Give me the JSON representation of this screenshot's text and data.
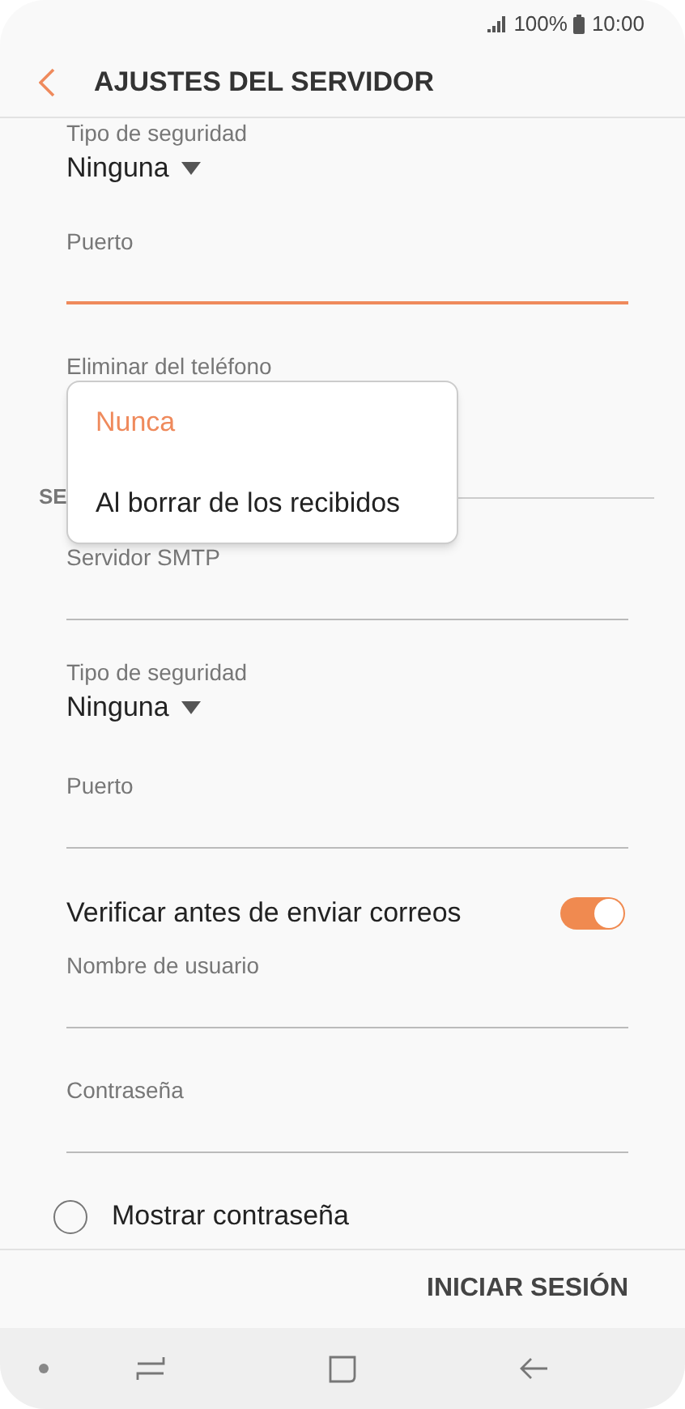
{
  "status_bar": {
    "battery": "100%",
    "time": "10:00"
  },
  "header": {
    "title": "AJUSTES DEL SERVIDOR"
  },
  "rows": [
    {
      "kind": "dropdown",
      "label": "Tipo de seguridad",
      "value": "Ninguna"
    },
    {
      "kind": "input",
      "label": "Puerto",
      "focused": true
    },
    {
      "kind": "dropdown_open",
      "label": "Eliminar del teléfono"
    },
    {
      "kind": "section",
      "title": "SE"
    },
    {
      "kind": "input",
      "label": "Servidor SMTP",
      "focused": false
    },
    {
      "kind": "dropdown",
      "label": "Tipo de seguridad",
      "value": "Ninguna"
    },
    {
      "kind": "input",
      "label": "Puerto",
      "focused": false
    },
    {
      "kind": "toggle",
      "label": "Verificar antes de enviar correos",
      "on": true
    },
    {
      "kind": "input",
      "label": "Nombre de usuario",
      "focused": false
    },
    {
      "kind": "input",
      "label": "Contraseña",
      "focused": false
    },
    {
      "kind": "radio",
      "label": "Mostrar contraseña",
      "checked": false
    }
  ],
  "popup": {
    "options": [
      {
        "label": "Nunca",
        "selected": true
      },
      {
        "label": "Al borrar de los recibidos",
        "selected": false
      }
    ]
  },
  "footer": {
    "button": "INICIAR SESIÓN"
  }
}
